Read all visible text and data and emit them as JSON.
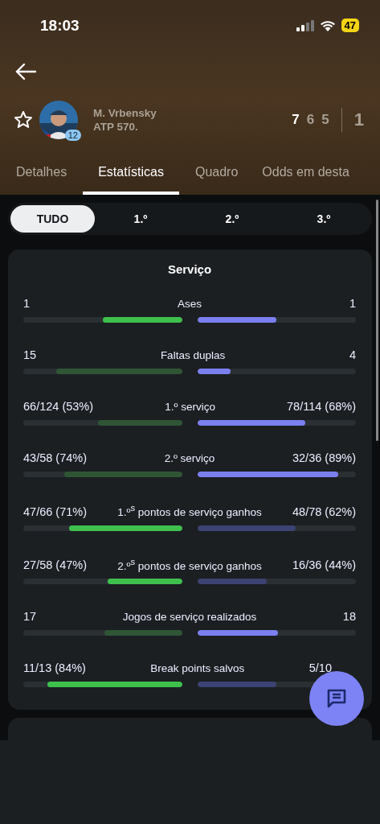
{
  "status_bar": {
    "time": "18:03",
    "battery": "47"
  },
  "player": {
    "name": "M. Vrbensky",
    "ranking": "ATP 570.",
    "seed": "12",
    "favorite": false
  },
  "score": {
    "sets": [
      {
        "value": "7",
        "highlighted": true
      },
      {
        "value": "6",
        "highlighted": false
      },
      {
        "value": "5",
        "highlighted": false
      }
    ],
    "total": "1"
  },
  "tabs": [
    {
      "label": "Detalhes",
      "selected": false
    },
    {
      "label": "Estatísticas",
      "selected": true
    },
    {
      "label": "Quadro",
      "selected": false
    },
    {
      "label": "Odds em desta",
      "selected": false
    }
  ],
  "periods": [
    {
      "label": "TUDO",
      "selected": true
    },
    {
      "label": "1.º",
      "selected": false
    },
    {
      "label": "2.º",
      "selected": false
    },
    {
      "label": "3.º",
      "selected": false
    }
  ],
  "section": {
    "title": "Serviço",
    "stats": [
      {
        "label": "Ases",
        "left": {
          "value": "1",
          "level": 0.5,
          "strong": true
        },
        "right": {
          "value": "1",
          "level": 0.5,
          "strong": true
        }
      },
      {
        "label": "Faltas duplas",
        "left": {
          "value": "15",
          "level": 0.79,
          "strong": false
        },
        "right": {
          "value": "4",
          "level": 0.21,
          "strong": true
        }
      },
      {
        "label": "1.º serviço",
        "left": {
          "value": "66/124 (53%)",
          "level": 0.53,
          "strong": false
        },
        "right": {
          "value": "78/114 (68%)",
          "level": 0.68,
          "strong": true
        }
      },
      {
        "label": "2.º serviço",
        "left": {
          "value": "43/58 (74%)",
          "level": 0.74,
          "strong": false
        },
        "right": {
          "value": "32/36 (89%)",
          "level": 0.89,
          "strong": true
        }
      },
      {
        "label": "1.º$^{s}$ pontos de serviço ganhos",
        "left": {
          "value": "47/66 (71%)",
          "level": 0.71,
          "strong": true
        },
        "right": {
          "value": "48/78 (62%)",
          "level": 0.62,
          "strong": false
        }
      },
      {
        "label": "2.º$^{s}$ pontos de serviço ganhos",
        "left": {
          "value": "27/58 (47%)",
          "level": 0.47,
          "strong": true
        },
        "right": {
          "value": "16/36 (44%)",
          "level": 0.44,
          "strong": false
        }
      },
      {
        "label": "Jogos de serviço realizados",
        "left": {
          "value": "17",
          "level": 0.49,
          "strong": false
        },
        "right": {
          "value": "18",
          "level": 0.51,
          "strong": true
        }
      },
      {
        "label": "Break points salvos",
        "left": {
          "value": "11/13 (84%)",
          "level": 0.85,
          "strong": true
        },
        "right": {
          "value": "5/10",
          "level": 0.5,
          "strong": false
        }
      }
    ]
  }
}
